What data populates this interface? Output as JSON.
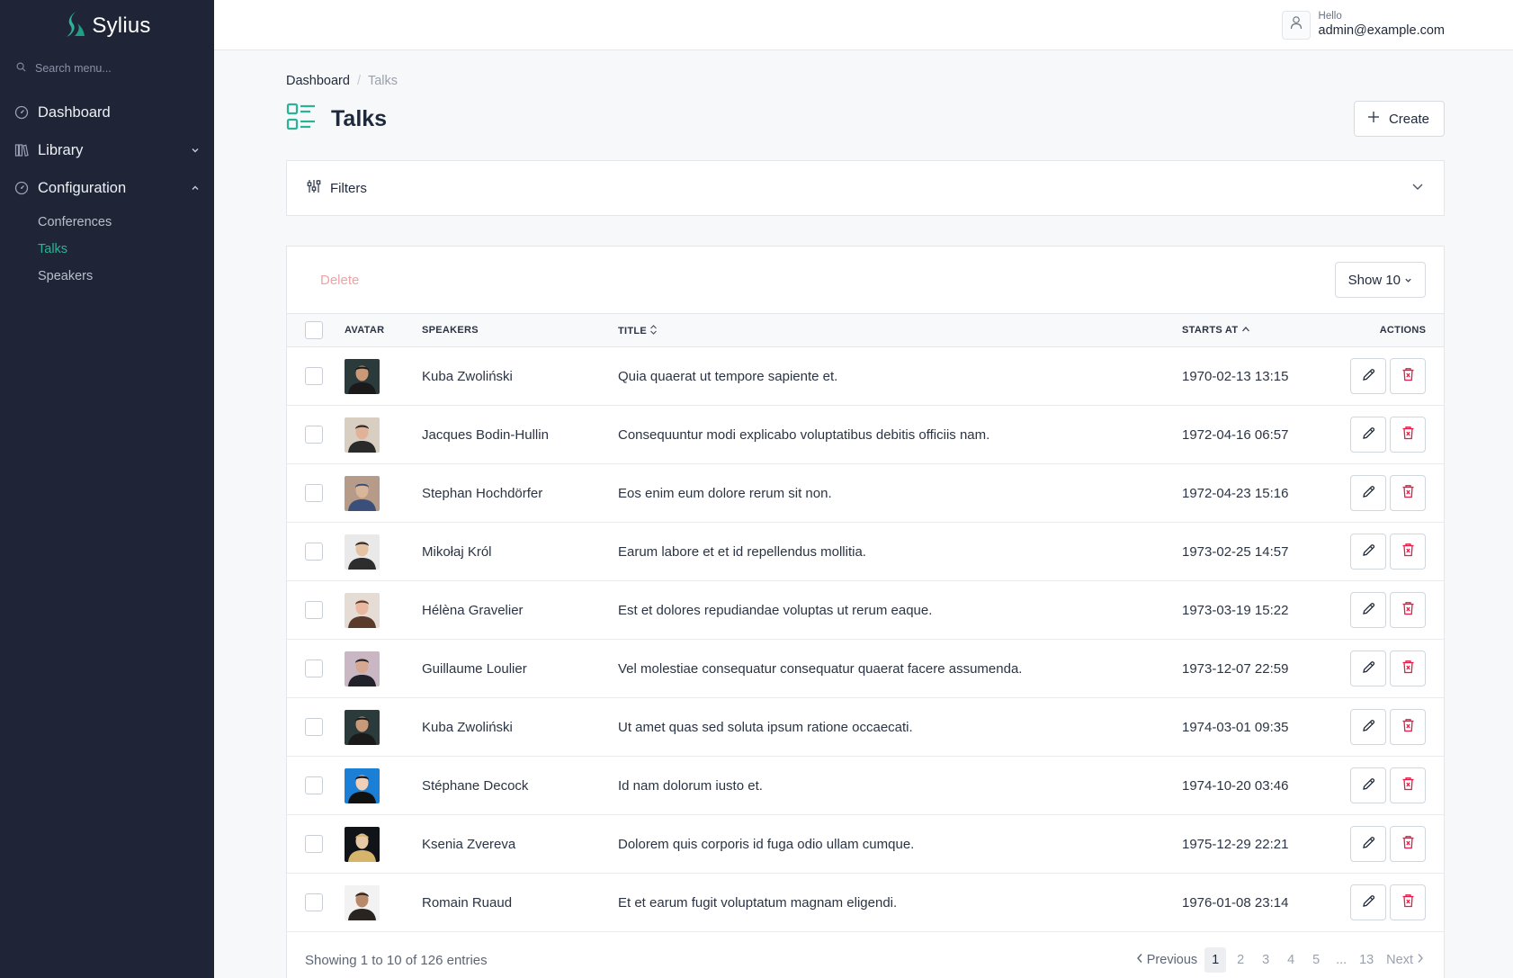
{
  "brand": {
    "name": "Sylius",
    "accent": "#2ab394",
    "sidebar_bg": "#1f2437"
  },
  "search": {
    "placeholder": "Search menu..."
  },
  "sidebar": {
    "items": [
      {
        "label": "Dashboard",
        "icon": "dashboard-icon"
      },
      {
        "label": "Library",
        "icon": "books-icon",
        "expanded": false
      },
      {
        "label": "Configuration",
        "icon": "gauge-icon",
        "expanded": true
      }
    ],
    "subitems": [
      {
        "label": "Conferences",
        "active": false
      },
      {
        "label": "Talks",
        "active": true
      },
      {
        "label": "Speakers",
        "active": false
      }
    ]
  },
  "user": {
    "greeting": "Hello",
    "email": "admin@example.com"
  },
  "breadcrumb": {
    "home": "Dashboard",
    "separator": "/",
    "current": "Talks"
  },
  "page": {
    "title": "Talks",
    "create_label": "Create"
  },
  "filters": {
    "label": "Filters"
  },
  "toolbar": {
    "delete_label": "Delete",
    "show_label": "Show 10"
  },
  "table": {
    "columns": {
      "avatar": "AVATAR",
      "speakers": "SPEAKERS",
      "title": "TITLE",
      "starts_at": "STARTS AT",
      "actions": "ACTIONS"
    },
    "rows": [
      {
        "speaker": "Kuba Zwoliński",
        "title": "Quia quaerat ut tempore sapiente et.",
        "starts_at": "1970-02-13 13:15"
      },
      {
        "speaker": "Jacques Bodin-Hullin",
        "title": "Consequuntur modi explicabo voluptatibus debitis officiis nam.",
        "starts_at": "1972-04-16 06:57"
      },
      {
        "speaker": "Stephan Hochdörfer",
        "title": "Eos enim eum dolore rerum sit non.",
        "starts_at": "1972-04-23 15:16"
      },
      {
        "speaker": "Mikołaj Król",
        "title": "Earum labore et et id repellendus mollitia.",
        "starts_at": "1973-02-25 14:57"
      },
      {
        "speaker": "Hélèna Gravelier",
        "title": "Est et dolores repudiandae voluptas ut rerum eaque.",
        "starts_at": "1973-03-19 15:22"
      },
      {
        "speaker": "Guillaume Loulier",
        "title": "Vel molestiae consequatur consequatur quaerat facere assumenda.",
        "starts_at": "1973-12-07 22:59"
      },
      {
        "speaker": "Kuba Zwoliński",
        "title": "Ut amet quas sed soluta ipsum ratione occaecati.",
        "starts_at": "1974-03-01 09:35"
      },
      {
        "speaker": "Stéphane Decock",
        "title": "Id nam dolorum iusto et.",
        "starts_at": "1974-10-20 03:46"
      },
      {
        "speaker": "Ksenia Zvereva",
        "title": "Dolorem quis corporis id fuga odio ullam cumque.",
        "starts_at": "1975-12-29 22:21"
      },
      {
        "speaker": "Romain Ruaud",
        "title": "Et et earum fugit voluptatum magnam eligendi.",
        "starts_at": "1976-01-08 23:14"
      }
    ]
  },
  "footer": {
    "showing": "Showing 1 to 10 of 126 entries",
    "prev_label": "Previous",
    "next_label": "Next",
    "pages": [
      "1",
      "2",
      "3",
      "4",
      "5",
      "...",
      "13"
    ],
    "current_page": "1"
  }
}
